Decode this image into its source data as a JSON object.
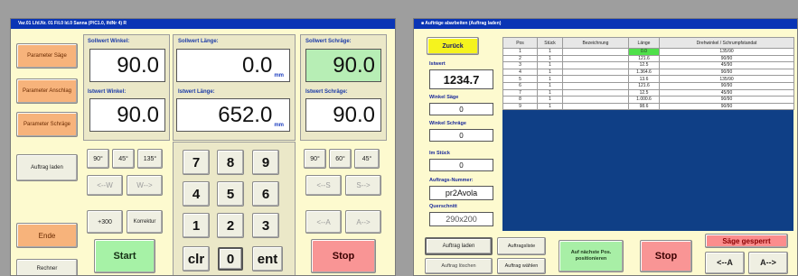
{
  "left_window": {
    "title": "Var.01   Lfd.Nr. 01     Fil.0   Id.0     Sanna          (P/C1.0, lfdNr 4) R",
    "side_buttons": {
      "param_saege": "Parameter Säge",
      "param_anschlag": "Parameter Anschlag",
      "param_schraege": "Parameter Schräge",
      "auftrag_laden": "Auftrag laden",
      "ende": "Ende",
      "rechner": "Rechner"
    },
    "winkel": {
      "soll_label": "Sollwert Winkel:",
      "soll_value": "90.0",
      "ist_label": "Istwert Winkel:",
      "ist_value": "90.0"
    },
    "laenge": {
      "soll_label": "Sollwert Länge:",
      "soll_value": "0.0",
      "ist_label": "Istwert Länge:",
      "ist_value": "652.0",
      "unit": "mm"
    },
    "schraege": {
      "soll_label": "Sollwert Schräge:",
      "soll_value": "90.0",
      "ist_label": "Istwert Schräge:",
      "ist_value": "90.0"
    },
    "angle_buttons": [
      "90°",
      "45°",
      "135°"
    ],
    "w_left": "<--W",
    "w_right": "W-->",
    "schraege_buttons": [
      "90°",
      "60°",
      "45°"
    ],
    "s_left": "<--S",
    "s_right": "S-->",
    "a_left": "<--A",
    "a_right": "A-->",
    "plus_button": "+300",
    "korrektur_button": "Korrektur",
    "keypad": [
      "7",
      "8",
      "9",
      "4",
      "5",
      "6",
      "1",
      "2",
      "3"
    ],
    "clr": "clr",
    "zero": "0",
    "ent": "ent",
    "start": "Start",
    "stop": "Stop"
  },
  "right_window": {
    "title": "Aufträge abarbeiten (Auftrag laden)",
    "zurueck": "Zurück",
    "istwert_label": "Istwert",
    "istwert_value": "1234.7",
    "winkel_saege_label": "Winkel Säge",
    "winkel_saege_value": "0",
    "winkel_schraege_label": "Winkel Schräge",
    "winkel_schraege_value": "0",
    "im_stueck_label": "Im Stück",
    "im_stueck_value": "0",
    "auftragsnummer_label": "Auftrags-Nummer:",
    "auftragsnummer_value": "pr2Avola",
    "querschnitt_label": "Querschnitt",
    "querschnitt_value": "290x200",
    "table": {
      "headers": [
        "Pos",
        "Stück",
        "Bezeichnung",
        "Länge",
        "Drehwinkel / Schrumpfstandat"
      ],
      "rows": [
        [
          "1",
          "1",
          "",
          "0.0",
          "135/90"
        ],
        [
          "2",
          "1",
          "",
          "121.6",
          "90/90"
        ],
        [
          "3",
          "1",
          "",
          "12.5",
          "45/90"
        ],
        [
          "4",
          "1",
          "",
          "1.364.6",
          "90/90"
        ],
        [
          "5",
          "1",
          "",
          "13.6",
          "135/90"
        ],
        [
          "6",
          "1",
          "",
          "121.6",
          "90/90"
        ],
        [
          "7",
          "1",
          "",
          "12.5",
          "45/90"
        ],
        [
          "8",
          "1",
          "",
          "1.000.6",
          "90/90"
        ],
        [
          "9",
          "1",
          "",
          "98.6",
          "90/90"
        ]
      ]
    },
    "auftrag_laden": "Auftrag laden",
    "auftrag_loeschen": "Auftrag löschen",
    "auftragsliste": "Auftragsliste",
    "auftrag_waehlen": "Auftrag wählen",
    "naechste_position": "Auf nächste Pos. positionieren",
    "stop": "Stop",
    "saege_gesperrt": "Säge gesperrt",
    "a_left": "<--A",
    "a_right": "A-->"
  }
}
